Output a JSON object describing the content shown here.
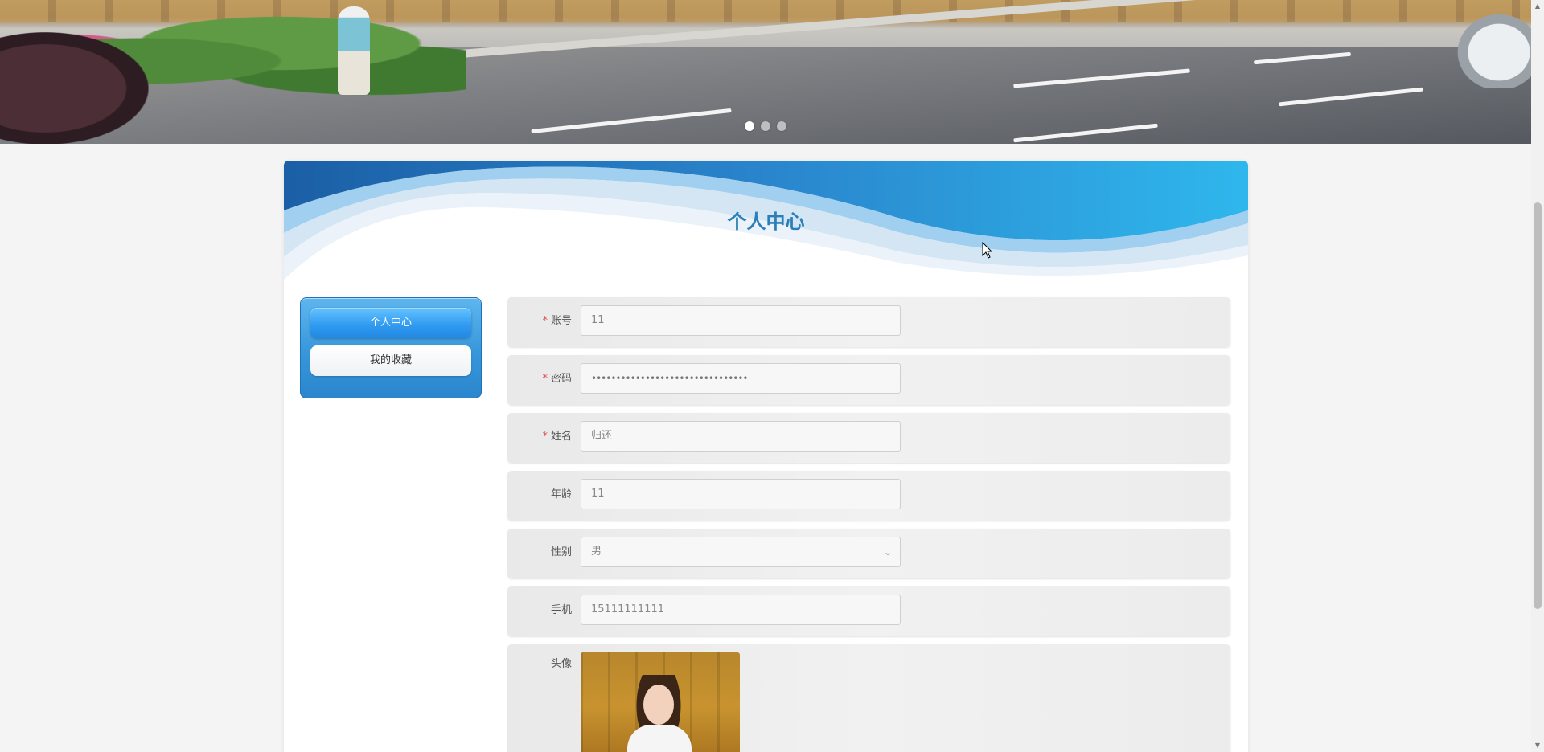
{
  "carousel": {
    "dots": [
      {
        "active": true
      },
      {
        "active": false
      },
      {
        "active": false
      }
    ]
  },
  "panel": {
    "title": "个人中心"
  },
  "menu": {
    "items": [
      {
        "label": "个人中心",
        "active": true
      },
      {
        "label": "我的收藏",
        "active": false
      }
    ]
  },
  "form": {
    "account": {
      "label": "账号",
      "required": true,
      "value": "11"
    },
    "password": {
      "label": "密码",
      "required": true,
      "value": "••••••••••••••••••••••••••••••••"
    },
    "name": {
      "label": "姓名",
      "required": true,
      "value": "归还"
    },
    "age": {
      "label": "年龄",
      "required": false,
      "value": "11"
    },
    "gender": {
      "label": "性别",
      "required": false,
      "value": "男",
      "icon": "chevron-down-icon"
    },
    "phone": {
      "label": "手机",
      "required": false,
      "value": "15111111111"
    },
    "avatar": {
      "label": "头像"
    }
  },
  "colors": {
    "accent": "#2b7fb9",
    "menu_blue": "#3797da",
    "required": "#e14a4a"
  }
}
